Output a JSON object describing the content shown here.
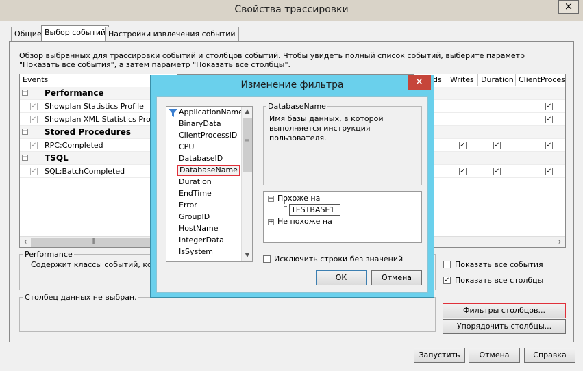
{
  "window": {
    "title": "Свойства трассировки",
    "close": "×"
  },
  "tabs": [
    "Общие",
    "Выбор событий",
    "Настройки извлечения событий"
  ],
  "description": "Обзор выбранных для трассировки событий и столбцов событий. Чтобы увидеть полный список событий, выберите параметр \"Показать все события\", а затем параметр \"Показать все столбцы\".",
  "grid": {
    "columns": [
      "Events",
      "ds",
      "Writes",
      "Duration",
      "ClientProcess"
    ],
    "rows": [
      {
        "type": "category",
        "label": "Performance"
      },
      {
        "type": "event",
        "label": "Showplan Statistics Profile"
      },
      {
        "type": "event",
        "label": "Showplan XML Statistics Profile"
      },
      {
        "type": "category",
        "label": "Stored Procedures"
      },
      {
        "type": "event",
        "label": "RPC:Completed"
      },
      {
        "type": "category",
        "label": "TSQL"
      },
      {
        "type": "event",
        "label": "SQL:BatchCompleted"
      }
    ]
  },
  "event_info": {
    "title": "Performance",
    "text": "Содержит классы событий, котор"
  },
  "column_info": {
    "title": "Столбец данных не выбран."
  },
  "options": {
    "show_all_events": "Показать все события",
    "show_all_columns": "Показать все столбцы"
  },
  "buttons": {
    "column_filters": "Фильтры столбцов...",
    "organize_columns": "Упорядочить столбцы...",
    "run": "Запустить",
    "cancel": "Отмена",
    "help": "Справка"
  },
  "filter_dialog": {
    "title": "Изменение фильтра",
    "close": "✕",
    "columns": [
      "ApplicationName",
      "BinaryData",
      "ClientProcessID",
      "CPU",
      "DatabaseID",
      "DatabaseName",
      "Duration",
      "EndTime",
      "Error",
      "GroupID",
      "HostName",
      "IntegerData",
      "IsSystem"
    ],
    "selected_column": "DatabaseName",
    "desc_title": "DatabaseName",
    "desc_text": "Имя базы данных, в которой выполняется инструкция пользователя.",
    "conditions": {
      "like": "Похоже на",
      "like_value": "TESTBASE1",
      "not_like": "Не похоже на"
    },
    "exclude_empty": "Исключить строки без значений",
    "ok": "ОК",
    "cancel": "Отмена"
  },
  "colors": {
    "dialog_frame": "#6ad0ec",
    "close_red": "#c6453a",
    "highlight_border": "#e0303a"
  }
}
